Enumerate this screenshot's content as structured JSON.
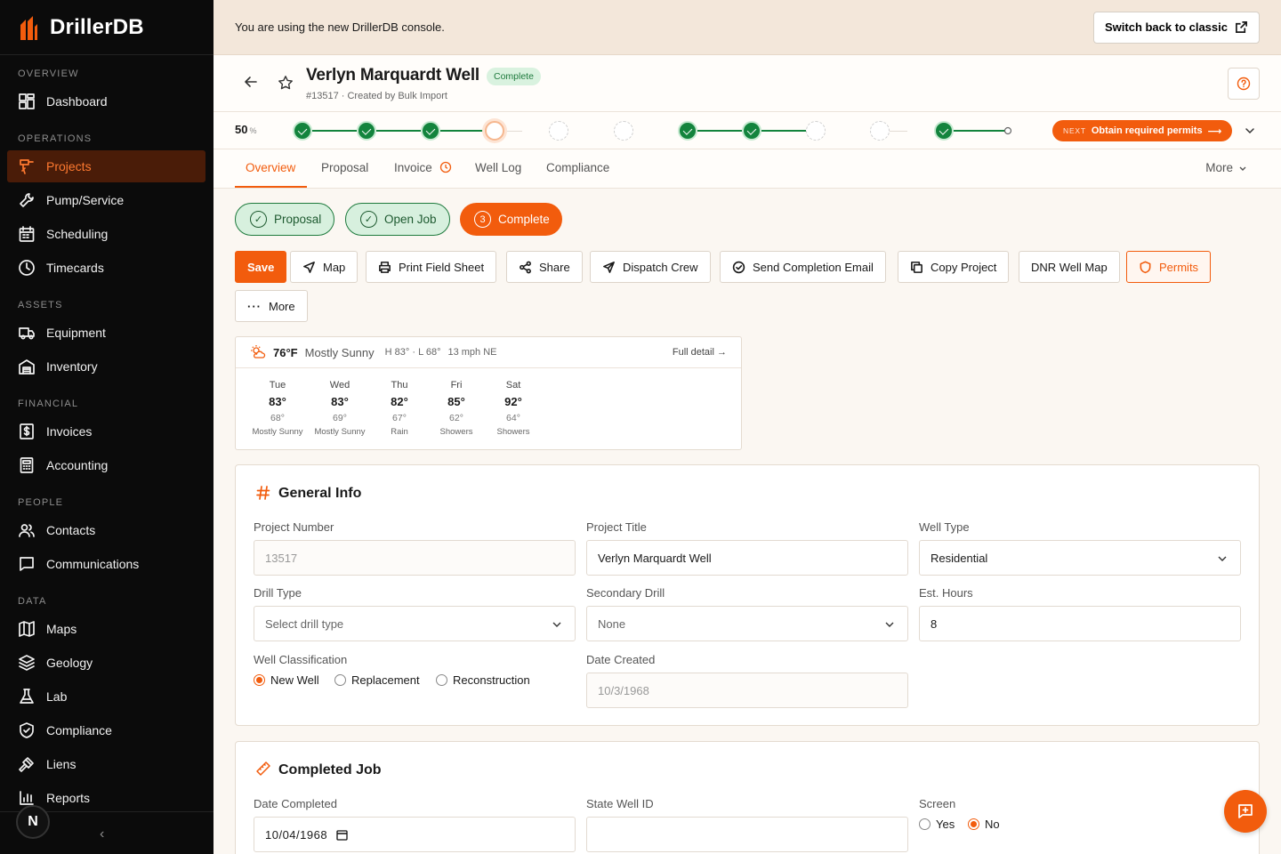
{
  "brand": {
    "name": "DrillerDB"
  },
  "sidebar": {
    "sections": [
      "OVERVIEW",
      "OPERATIONS",
      "ASSETS",
      "FINANCIAL",
      "PEOPLE",
      "DATA"
    ],
    "items": [
      {
        "label": "Dashboard",
        "icon": "dashboard-icon"
      },
      {
        "label": "Projects",
        "icon": "drill-icon",
        "active": true
      },
      {
        "label": "Pump/Service",
        "icon": "wrench-icon"
      },
      {
        "label": "Scheduling",
        "icon": "calendar-icon"
      },
      {
        "label": "Timecards",
        "icon": "clock-icon"
      },
      {
        "label": "Equipment",
        "icon": "truck-icon"
      },
      {
        "label": "Inventory",
        "icon": "warehouse-icon"
      },
      {
        "label": "Invoices",
        "icon": "dollar-icon"
      },
      {
        "label": "Accounting",
        "icon": "calculator-icon"
      },
      {
        "label": "Contacts",
        "icon": "users-icon"
      },
      {
        "label": "Communications",
        "icon": "chat-icon"
      },
      {
        "label": "Maps",
        "icon": "map-icon"
      },
      {
        "label": "Geology",
        "icon": "layers-icon"
      },
      {
        "label": "Lab",
        "icon": "flask-icon"
      },
      {
        "label": "Compliance",
        "icon": "shield-icon"
      },
      {
        "label": "Liens",
        "icon": "gavel-icon"
      },
      {
        "label": "Reports",
        "icon": "bar-chart-icon"
      }
    ],
    "avatar_initial": "N"
  },
  "banner": {
    "text": "You are using the new DrillerDB console.",
    "switch_label": "Switch back to classic"
  },
  "header": {
    "title": "Verlyn Marquardt Well",
    "status": "Complete",
    "subtitle": "#13517 · Created by Bulk Import"
  },
  "progress": {
    "percent": "50",
    "unit": "%",
    "percent_value": 50,
    "next_tag": "NEXT",
    "next_label": "Obtain required permits"
  },
  "tabs": [
    "Overview",
    "Proposal",
    "Invoice",
    "Well Log",
    "Compliance"
  ],
  "tabs_more": "More",
  "stages": [
    {
      "label": "Proposal",
      "state": "done"
    },
    {
      "label": "Open Job",
      "state": "done"
    },
    {
      "label": "Complete",
      "state": "active",
      "number": "3"
    }
  ],
  "actions": {
    "save": "Save",
    "map": "Map",
    "print": "Print Field Sheet",
    "share": "Share",
    "dispatch": "Dispatch Crew",
    "email": "Send Completion Email",
    "copy": "Copy Project",
    "dnr": "DNR Well Map",
    "permits": "Permits",
    "more": "More"
  },
  "weather": {
    "temp": "76°F",
    "condition": "Mostly Sunny",
    "hilo": "H 83° · L 68°",
    "wind": "13 mph NE",
    "detail_link": "Full detail →",
    "days": [
      {
        "day": "Tue",
        "hi": "83°",
        "lo": "68°",
        "cond": "Mostly Sunny"
      },
      {
        "day": "Wed",
        "hi": "83°",
        "lo": "69°",
        "cond": "Mostly Sunny"
      },
      {
        "day": "Thu",
        "hi": "82°",
        "lo": "67°",
        "cond": "Rain"
      },
      {
        "day": "Fri",
        "hi": "85°",
        "lo": "62°",
        "cond": "Showers"
      },
      {
        "day": "Sat",
        "hi": "92°",
        "lo": "64°",
        "cond": "Showers"
      }
    ]
  },
  "general": {
    "title": "General Info",
    "project_number_label": "Project Number",
    "project_number": "13517",
    "project_title_label": "Project Title",
    "project_title": "Verlyn Marquardt Well",
    "well_type_label": "Well Type",
    "well_type": "Residential",
    "drill_type_label": "Drill Type",
    "drill_type_placeholder": "Select drill type",
    "secondary_drill_label": "Secondary Drill",
    "secondary_drill": "None",
    "est_hours_label": "Est. Hours",
    "est_hours": "8",
    "classification_label": "Well Classification",
    "classification_options": [
      "New Well",
      "Replacement",
      "Reconstruction"
    ],
    "classification_selected": "New Well",
    "date_created_label": "Date Created",
    "date_created": "10/3/1968"
  },
  "completed": {
    "title": "Completed Job",
    "date_completed_label": "Date Completed",
    "date_completed": "10/04/1968",
    "state_well_id_label": "State Well ID",
    "state_well_id": "",
    "screen_label": "Screen",
    "screen_options": [
      "Yes",
      "No"
    ],
    "screen_selected": "No"
  },
  "colors": {
    "accent": "#f25c0d",
    "success": "#13843d",
    "sidebar": "#0b0b0b",
    "banner": "#f3e7da"
  }
}
